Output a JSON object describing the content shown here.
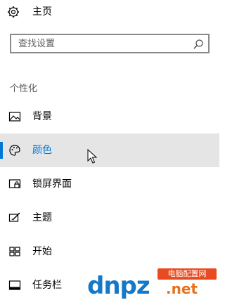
{
  "home": {
    "label": "主页",
    "icon": "gear-icon"
  },
  "search": {
    "placeholder": "查找设置",
    "icon": "search-icon"
  },
  "section_title": "个性化",
  "nav": {
    "items": [
      {
        "label": "背景",
        "icon": "image-icon",
        "selected": false
      },
      {
        "label": "颜色",
        "icon": "palette-icon",
        "selected": true
      },
      {
        "label": "锁屏界面",
        "icon": "lock-screen-icon",
        "selected": false
      },
      {
        "label": "主题",
        "icon": "theme-icon",
        "selected": false
      },
      {
        "label": "开始",
        "icon": "start-icon",
        "selected": false
      },
      {
        "label": "任务栏",
        "icon": "taskbar-icon",
        "selected": false
      }
    ]
  },
  "watermark": {
    "main": "dnpz",
    "net": ".net",
    "badge": "电脑配置网"
  },
  "colors": {
    "accent": "#0078d7",
    "selected_bg": "#e5e5e5",
    "watermark_blue": "#1479c9",
    "watermark_orange": "#e8711a"
  }
}
